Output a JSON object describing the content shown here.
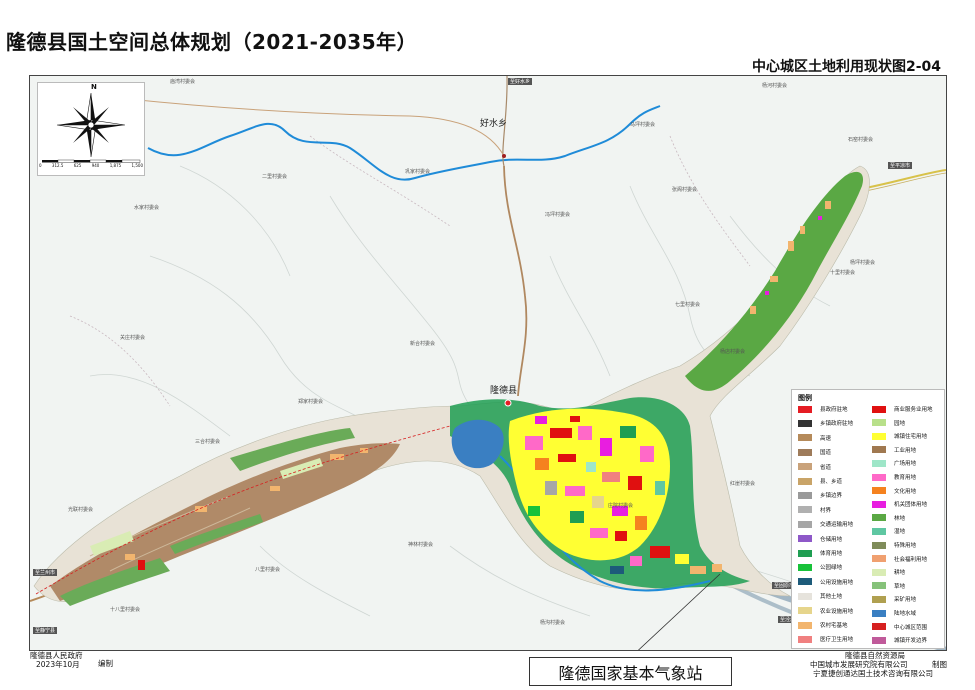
{
  "title": "隆德县国土空间总体规划（2021-2035年）",
  "subtitle": "中心城区土地利用现状图2-04",
  "compass": {
    "north": "N",
    "scale_ticks": [
      "0",
      "312.5",
      "625",
      "940",
      "1,875",
      "1,500"
    ]
  },
  "map_labels": {
    "haoshui": "好水乡",
    "longde": "隆德县",
    "villages": [
      "庙湾村委会",
      "杨河村委会",
      "马坪村委会",
      "巩家村委会",
      "二里村委会",
      "水家村委会",
      "冯坪村委会",
      "张阁村委会",
      "石窑村委会",
      "杨坪村委会",
      "十里村委会",
      "七里村委会",
      "杨店村委会",
      "关庄村委会",
      "新合村委会",
      "郑家村委会",
      "三合村委会",
      "光联村委会",
      "八里村委会",
      "神林村委会",
      "红崖村委会",
      "庄院村委会",
      "杨沟村委会",
      "十八里村委会"
    ],
    "roads": [
      "至好水乡",
      "至平凉市",
      "至兰州市",
      "至静宁县",
      "至固原市",
      "至泾源县"
    ]
  },
  "legend": {
    "title": "图例",
    "left": [
      {
        "label": "县政府驻地",
        "color": "#e51c23"
      },
      {
        "label": "乡镇政府驻地",
        "color": "#333333"
      },
      {
        "label": "高速",
        "color": "#b58a5a"
      },
      {
        "label": "国道",
        "color": "#9e7b5a"
      },
      {
        "label": "省道",
        "color": "#c9a27a"
      },
      {
        "label": "县、乡道",
        "color": "#c9a468"
      },
      {
        "label": "乡镇边界",
        "color": "#9a9a9a"
      },
      {
        "label": "村界",
        "color": "#b0b0b0"
      },
      {
        "label": "交通运输用地",
        "color": "#a6a6a6"
      },
      {
        "label": "仓储用地",
        "color": "#8e58c8"
      },
      {
        "label": "体育用地",
        "color": "#1f9e52"
      },
      {
        "label": "公园绿地",
        "color": "#18c23a"
      },
      {
        "label": "公用设施用地",
        "color": "#1d5b7a"
      },
      {
        "label": "其他土地",
        "color": "#e6e3dc"
      },
      {
        "label": "农业设施用地",
        "color": "#e6d58c"
      },
      {
        "label": "农村宅基地",
        "color": "#f2b56e"
      },
      {
        "label": "医疗卫生用地",
        "color": "#f08080"
      }
    ],
    "right": [
      {
        "label": "商业服务业用地",
        "color": "#e01010"
      },
      {
        "label": "园地",
        "color": "#b8e08a"
      },
      {
        "label": "城镇住宅用地",
        "color": "#ffff33"
      },
      {
        "label": "工业用地",
        "color": "#a07850"
      },
      {
        "label": "广场用地",
        "color": "#9ee6c8"
      },
      {
        "label": "教育用地",
        "color": "#ff69c8"
      },
      {
        "label": "文化用地",
        "color": "#f5821f"
      },
      {
        "label": "机关团体用地",
        "color": "#e81ee0"
      },
      {
        "label": "林地",
        "color": "#5aa844"
      },
      {
        "label": "湿地",
        "color": "#5fc7a2"
      },
      {
        "label": "特殊用地",
        "color": "#7f8c5a"
      },
      {
        "label": "社会福利用地",
        "color": "#f0a070"
      },
      {
        "label": "耕地",
        "color": "#d9ecb4"
      },
      {
        "label": "草地",
        "color": "#86c27a"
      },
      {
        "label": "采矿用地",
        "color": "#b0a050"
      },
      {
        "label": "陆地水域",
        "color": "#3a7fc2"
      },
      {
        "label": "中心城区范围",
        "color": "#d62020"
      },
      {
        "label": "城镇开发边界",
        "color": "#c05a9a"
      }
    ]
  },
  "footer": {
    "gov": "隆德县人民政府",
    "date": "2023年10月",
    "compile": "编制",
    "bureau": "隆德县自然资源局",
    "institute": "中国城市发展研究院有限公司",
    "company": "宁夏捷创通达国土技术咨询有限公司",
    "produce": "制图"
  },
  "callout": "隆德国家基本气象站",
  "colors": {
    "river": "#1f8bd8",
    "road": "#b08860",
    "water": "#3a7fc2"
  }
}
